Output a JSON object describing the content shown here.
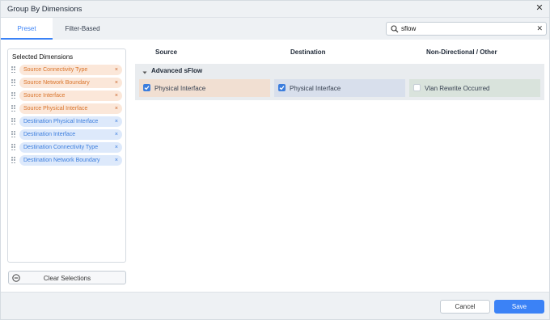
{
  "dialog": {
    "title": "Group By Dimensions"
  },
  "tabs": [
    {
      "label": "Preset",
      "active": true
    },
    {
      "label": "Filter-Based",
      "active": false
    }
  ],
  "search": {
    "value": "sflow",
    "placeholder": ""
  },
  "selected_panel": {
    "title": "Selected Dimensions",
    "items": [
      {
        "label": "Source Connectivity Type",
        "kind": "source"
      },
      {
        "label": "Source Network Boundary",
        "kind": "source"
      },
      {
        "label": "Source Interface",
        "kind": "source"
      },
      {
        "label": "Source Physical Interface",
        "kind": "source"
      },
      {
        "label": "Destination Physical Interface",
        "kind": "destination"
      },
      {
        "label": "Destination Interface",
        "kind": "destination"
      },
      {
        "label": "Destination Connectivity Type",
        "kind": "destination"
      },
      {
        "label": "Destination Network Boundary",
        "kind": "destination"
      }
    ],
    "remove_glyph": "×"
  },
  "clear_button": {
    "label": "Clear Selections"
  },
  "columns": {
    "source": "Source",
    "destination": "Destination",
    "other": "Non-Directional / Other"
  },
  "section": {
    "title": "Advanced sFlow",
    "expanded": true,
    "options": [
      {
        "label": "Physical Interface",
        "column": "source",
        "checked": true
      },
      {
        "label": "Physical Interface",
        "column": "destination",
        "checked": true
      },
      {
        "label": "Vlan Rewrite Occurred",
        "column": "other",
        "checked": false
      }
    ]
  },
  "footer": {
    "cancel_label": "Cancel",
    "save_label": "Save"
  },
  "colors": {
    "accent": "#3b82f6",
    "source_chip_bg": "#fbe7d9",
    "source_chip_text": "#d9742b",
    "destination_chip_bg": "#dde9fb",
    "destination_chip_text": "#3b7ddd"
  },
  "icons": {
    "close": "close-icon",
    "search": "search-icon",
    "clear_search": "clear-search-icon",
    "drag": "drag-handle-icon",
    "remove": "remove-icon",
    "clear_selections": "minus-circle-icon",
    "caret": "caret-down-icon",
    "checkbox_checked": "checkbox-checked-icon",
    "checkbox_unchecked": "checkbox-unchecked-icon"
  }
}
